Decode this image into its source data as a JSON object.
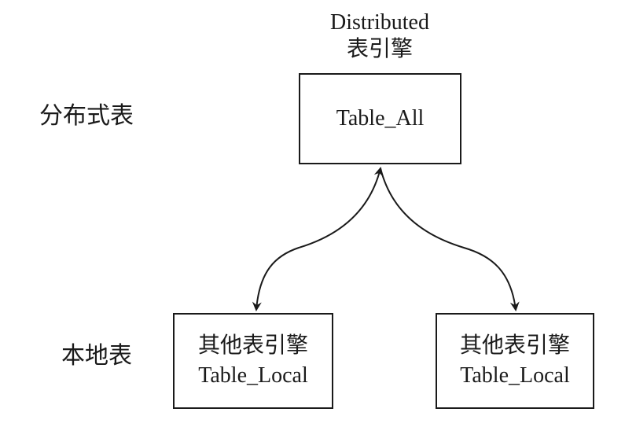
{
  "diagram": {
    "engine_title": {
      "line1": "Distributed",
      "line2": "表引擎"
    },
    "row_labels": {
      "distributed": "分布式表",
      "local": "本地表"
    },
    "distributed_table": {
      "name": "Table_All"
    },
    "local_tables": [
      {
        "engine": "其他表引擎",
        "name": "Table_Local"
      },
      {
        "engine": "其他表引擎",
        "name": "Table_Local"
      }
    ],
    "connections": [
      {
        "from": "Table_All",
        "to": "Table_Local (left)",
        "direction": "bidirectional"
      },
      {
        "from": "Table_All",
        "to": "Table_Local (right)",
        "direction": "bidirectional"
      }
    ]
  }
}
